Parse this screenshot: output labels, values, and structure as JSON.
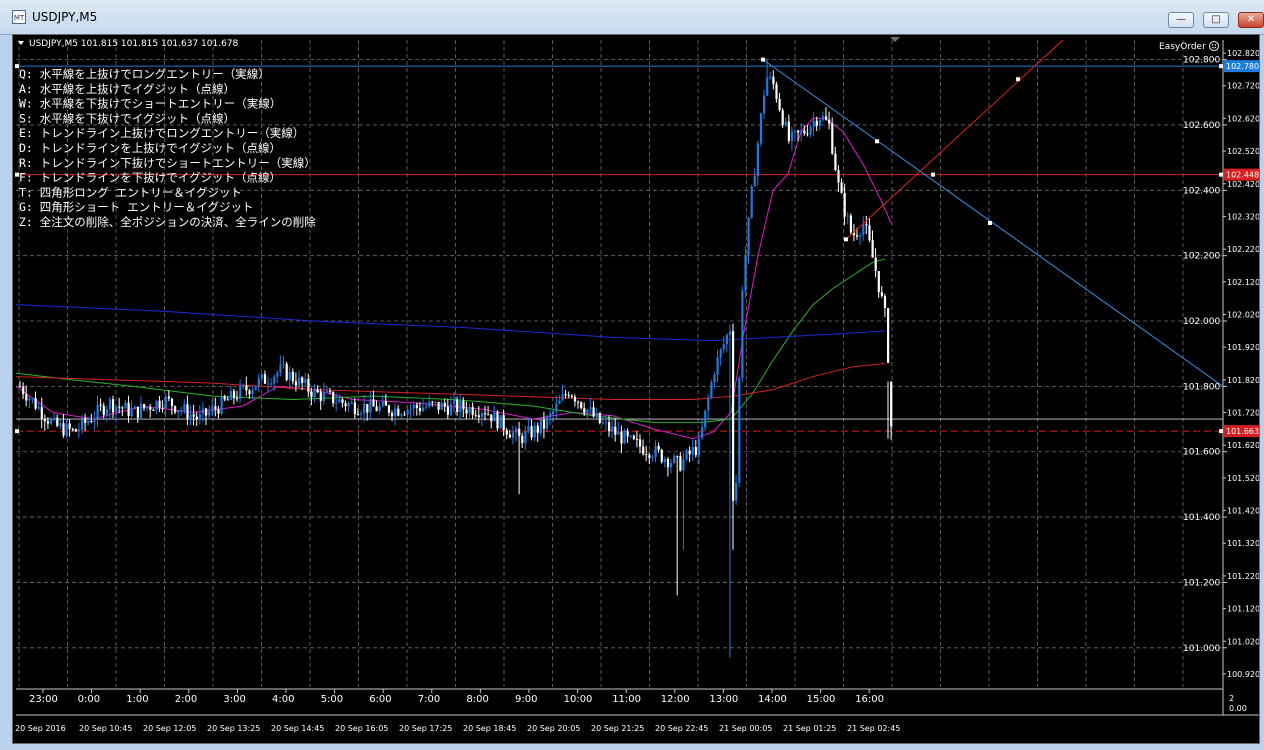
{
  "window": {
    "title": "USDJPY,M5",
    "icon_label": "MT",
    "buttons": [
      "minimize-icon",
      "maximize-icon",
      "close-icon"
    ]
  },
  "chart_header": {
    "symbol_line": "USDJPY,M5  101.815 101.815 101.637 101.678",
    "expert_name": "EasyOrder",
    "expert_icon": "smiley-icon"
  },
  "shortcuts": [
    "Q: 水平線を上抜けでロングエントリー（実線）",
    "A: 水平線を上抜けでイグジット（点線）",
    "W: 水平線を下抜けでショートエントリー（実線）",
    "S: 水平線を下抜けでイグジット（点線）",
    "E: トレンドライン上抜けでロングエントリー（実線）",
    "D: トレンドラインを上抜けでイグジット（点線）",
    "R: トレンドライン下抜けでショートエントリー（実線）",
    "F: トレンドラインを下抜けでイグジット（点線）",
    "T: 四角形ロング エントリー＆イグジット",
    "G: 四角形ショート エントリー＆イグジット",
    "Z: 全注文の削除、全ポジションの決済、全ラインの削除"
  ],
  "price_labels": {
    "major": [
      "102.800",
      "102.600",
      "102.400",
      "102.200",
      "102.000",
      "101.800",
      "101.600",
      "101.400",
      "101.200",
      "101.000"
    ],
    "minor": [
      "102.820",
      "102.720",
      "102.620",
      "102.520",
      "102.420",
      "102.320",
      "102.220",
      "102.120",
      "102.020",
      "101.920",
      "101.820",
      "101.720",
      "101.620",
      "101.520",
      "101.420",
      "101.320",
      "101.220",
      "101.120",
      "101.020",
      "100.920"
    ],
    "markers": [
      {
        "value": "102.780",
        "color": "#1e7be0"
      },
      {
        "value": "102.448",
        "color": "#d81e1e"
      },
      {
        "value": "101.663",
        "color": "#d81e1e"
      }
    ]
  },
  "time_labels": [
    "23:00",
    "0:00",
    "1:00",
    "2:00",
    "3:00",
    "4:00",
    "5:00",
    "6:00",
    "7:00",
    "8:00",
    "9:00",
    "10:00",
    "11:00",
    "12:00",
    "13:00",
    "14:00",
    "15:00",
    "16:00"
  ],
  "date_labels": [
    "20 Sep 2016",
    "20 Sep 10:45",
    "20 Sep 12:05",
    "20 Sep 13:25",
    "20 Sep 14:45",
    "20 Sep 16:05",
    "20 Sep 17:25",
    "20 Sep 18:45",
    "20 Sep 20:05",
    "20 Sep 21:25",
    "20 Sep 22:45",
    "21 Sep 00:05",
    "21 Sep 01:25",
    "21 Sep 02:45"
  ],
  "indicator_panel": {
    "top_label": "2",
    "bottom_label": "0.00"
  },
  "chart_data": {
    "type": "candlestick",
    "symbol": "USDJPY",
    "timeframe": "M5",
    "ylim": [
      100.88,
      102.86
    ],
    "x_labels": [
      "23:00",
      "0:00",
      "1:00",
      "2:00",
      "3:00",
      "4:00",
      "5:00",
      "6:00",
      "7:00",
      "8:00",
      "9:00",
      "10:00",
      "11:00",
      "12:00",
      "13:00",
      "14:00",
      "15:00",
      "16:00"
    ],
    "last_bar": {
      "open": 101.815,
      "high": 101.815,
      "low": 101.637,
      "close": 101.678
    },
    "key_points": [
      {
        "time": "13:00",
        "low": 100.95
      },
      {
        "time": "14:00",
        "high": 102.8
      },
      {
        "time": "16:00",
        "close": 101.678
      }
    ],
    "horizontal_lines": [
      {
        "price": 102.78,
        "color": "#1e7be0",
        "style": "solid"
      },
      {
        "price": 102.448,
        "color": "#d81e1e",
        "style": "solid"
      },
      {
        "price": 101.663,
        "color": "#d81e1e",
        "style": "dashed"
      }
    ],
    "colors": {
      "background": "#000000",
      "grid": "#6e6e6e",
      "bull": "#1e7be0",
      "bear": "#ffffff",
      "ma_fast": "#d81ec8",
      "ma_mid": "#28b428",
      "ma_slow": "#d81e1e",
      "ma_long": "#1e2ad8",
      "trend_down": "#3b8ee6",
      "trend_up": "#e01e1e"
    }
  }
}
